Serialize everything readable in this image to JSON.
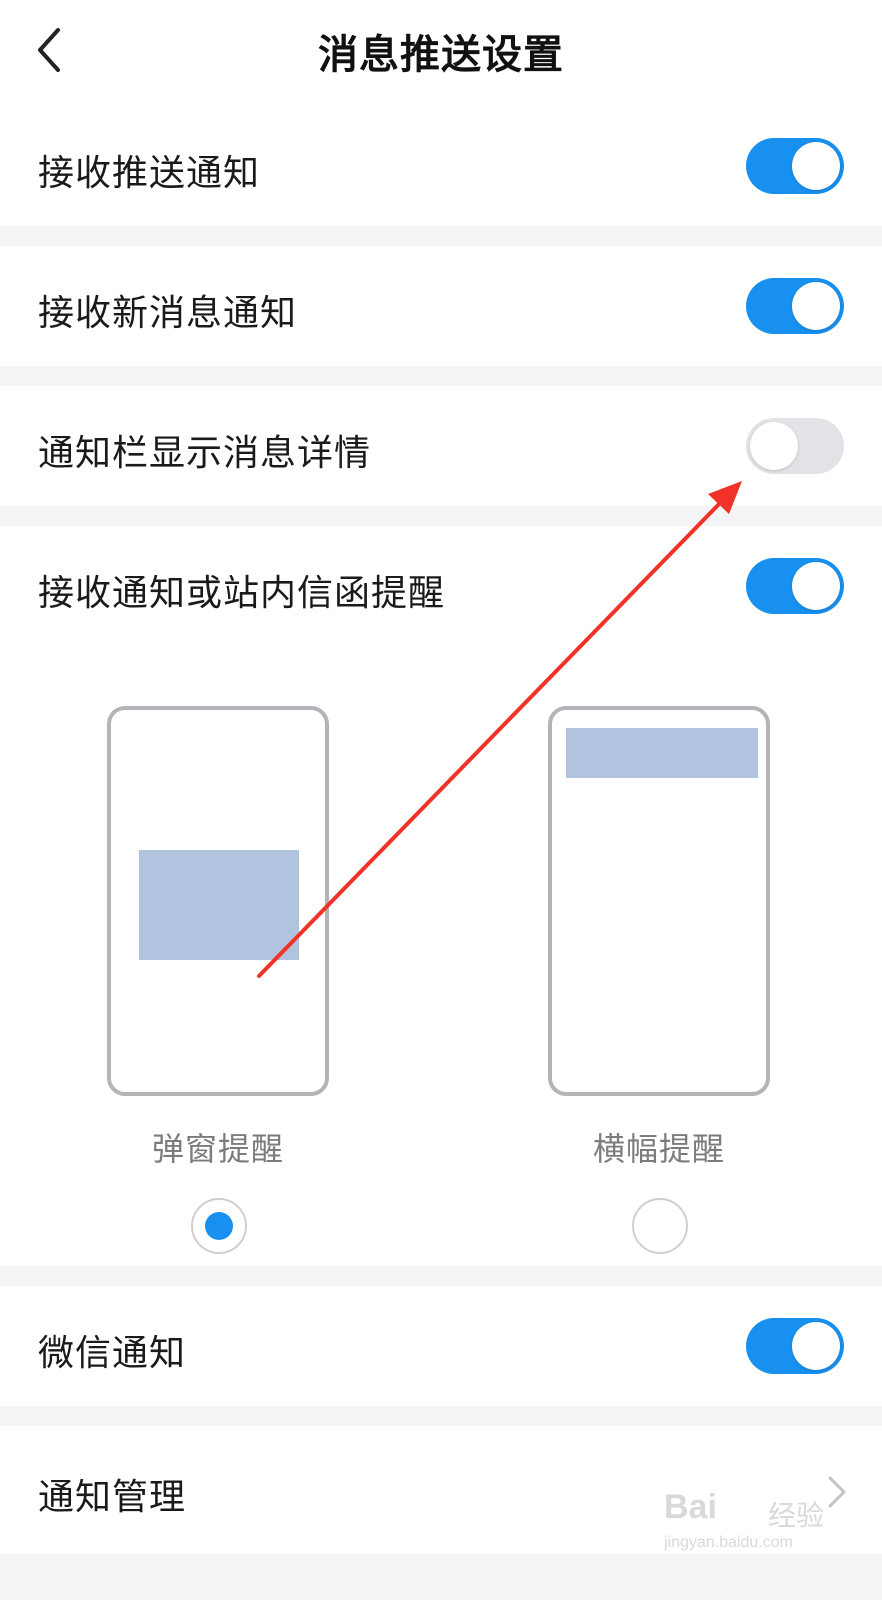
{
  "header": {
    "title": "消息推送设置"
  },
  "rows": [
    {
      "label": "接收推送通知",
      "on": true
    },
    {
      "label": "接收新消息通知",
      "on": true
    },
    {
      "label": "通知栏显示消息详情",
      "on": false
    },
    {
      "label": "接收通知或站内信函提醒",
      "on": true
    },
    {
      "label": "微信通知",
      "on": true
    }
  ],
  "reminder_options": [
    {
      "label": "弹窗提醒",
      "selected": true
    },
    {
      "label": "横幅提醒",
      "selected": false
    }
  ],
  "manage": {
    "label": "通知管理"
  },
  "watermark": {
    "logo": "Bai",
    "cn": "经验",
    "url": "jingyan.baidu.com"
  },
  "colors": {
    "accent": "#1890f0",
    "toggle_off": "#e1e3e6",
    "annotation_arrow": "#f03228",
    "preview_fill": "#b2c3e0"
  }
}
